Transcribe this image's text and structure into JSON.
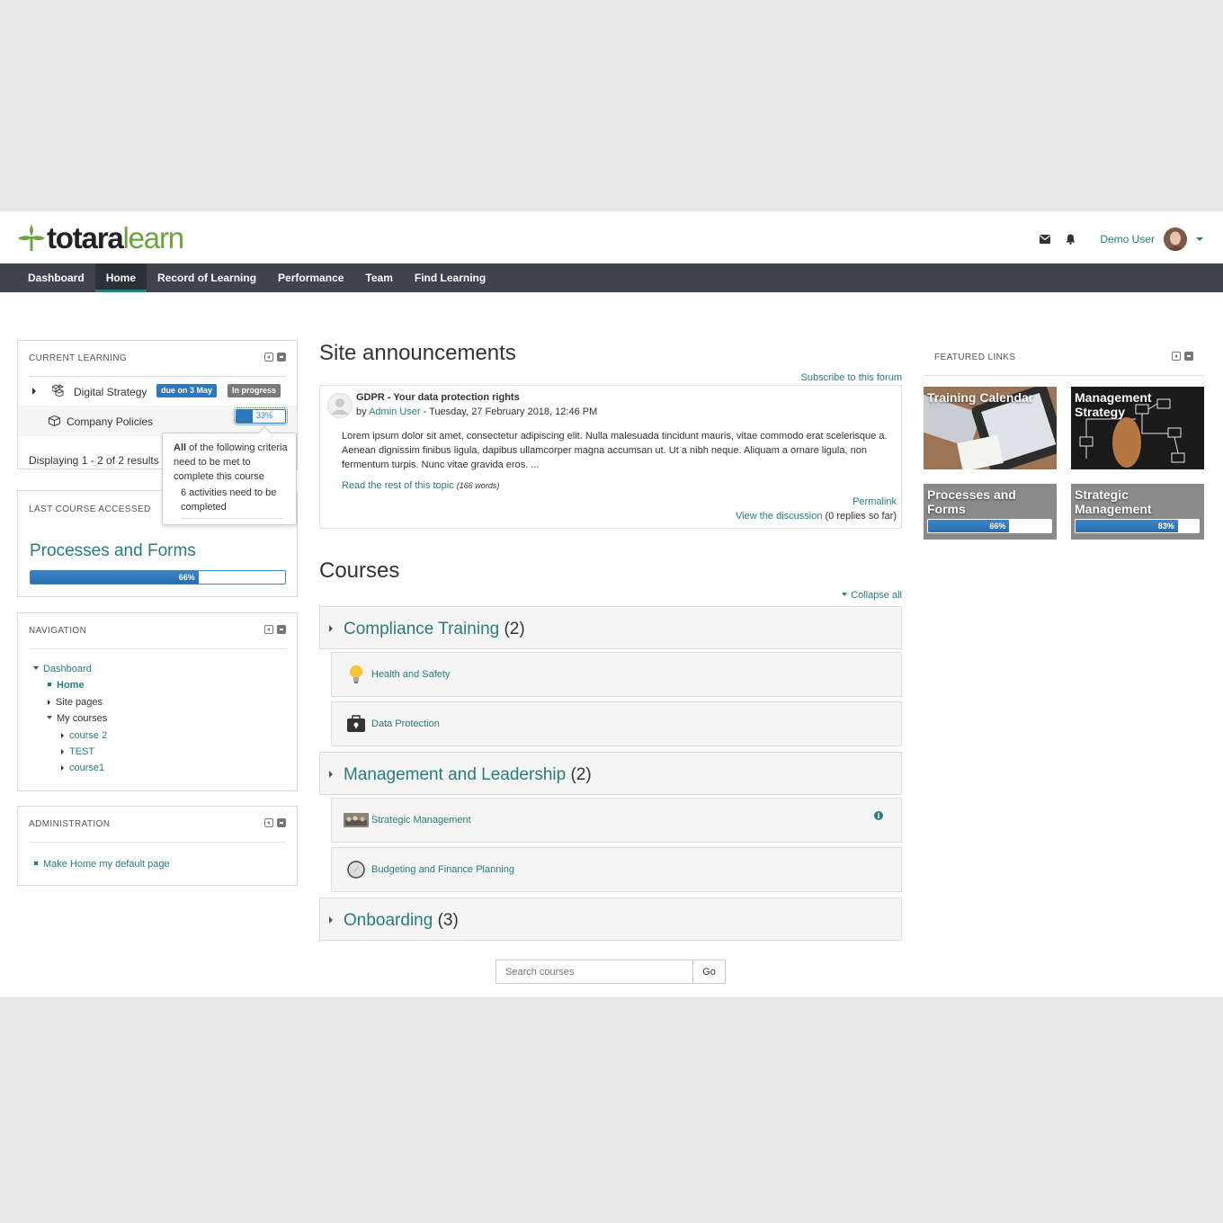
{
  "header": {
    "logo_part1": "totara",
    "logo_part2": "learn",
    "user_name": "Demo User"
  },
  "nav": [
    "Dashboard",
    "Home",
    "Record of Learning",
    "Performance",
    "Team",
    "Find Learning"
  ],
  "current_learning": {
    "title": "CURRENT LEARNING",
    "items": [
      {
        "name": "Digital Strategy",
        "badge_due": "due on 3 May",
        "badge_status": "In progress"
      },
      {
        "name": "Company Policies",
        "progress_label": "33%",
        "progress": 0.33
      }
    ],
    "footer": "Displaying 1 - 2 of 2 results",
    "tooltip": {
      "line1_bold": "All",
      "line1_rest": "of the following criteria need to be met to complete this course",
      "line2": "6 activities need to be completed"
    }
  },
  "last_course": {
    "title": "LAST COURSE ACCESSED",
    "course": "Processes and Forms",
    "progress_label": "66%",
    "progress": 0.66
  },
  "navigation": {
    "title": "NAVIGATION",
    "dashboard": "Dashboard",
    "home": "Home",
    "site_pages": "Site pages",
    "my_courses": "My courses",
    "courses": [
      "course 2",
      "TEST",
      "course1"
    ]
  },
  "administration": {
    "title": "ADMINISTRATION",
    "item": "Make Home my default page"
  },
  "announcements": {
    "heading": "Site announcements",
    "subscribe": "Subscribe to this forum",
    "post_title": "GDPR - Your data protection rights",
    "by": "by",
    "author": "Admin User",
    "date": "- Tuesday, 27 February 2018, 12:46 PM",
    "body": "Lorem ipsum dolor sit amet, consectetur adipiscing elit. Nulla malesuada tincidunt mauris, vitae commodo erat scelerisque a. Aenean dignissim finibus ligula, dapibus ullamcorper magna accumsan ut. Ut a nibh neque. Aliquam a ornare ligula, non fermentum turpis. Nunc vitae gravida eros. ...",
    "read_more": "Read the rest of this topic",
    "words": "(166 words)",
    "permalink": "Permalink",
    "view_discussion": "View the discussion",
    "replies": "(0 replies so far)"
  },
  "courses": {
    "heading": "Courses",
    "collapse_all": "Collapse all",
    "cat1": {
      "name": "Compliance Training",
      "count": "(2)"
    },
    "cat1_courses": [
      "Health and Safety",
      "Data Protection"
    ],
    "cat2": {
      "name": "Management and Leadership",
      "count": "(2)"
    },
    "cat2_courses": [
      "Strategic Management",
      "Budgeting and Finance Planning"
    ],
    "cat3": {
      "name": "Onboarding",
      "count": "(3)"
    },
    "search_placeholder": "Search courses",
    "go": "Go"
  },
  "featured": {
    "title": "FEATURED LINKS",
    "tiles": [
      {
        "title": "Training Calendar"
      },
      {
        "title": "Management Strategy"
      },
      {
        "title": "Processes and Forms",
        "progress_label": "66%",
        "progress": 0.66
      },
      {
        "title": "Strategic Management",
        "progress_label": "83%",
        "progress": 0.83
      }
    ]
  },
  "colors": {
    "accent": "#287b7e",
    "brand_green": "#69a43c",
    "navbar": "#3d444b",
    "progress_blue": "#2f78bd",
    "badge_due": "#2f78bd",
    "badge_status": "#7a7a7a"
  }
}
